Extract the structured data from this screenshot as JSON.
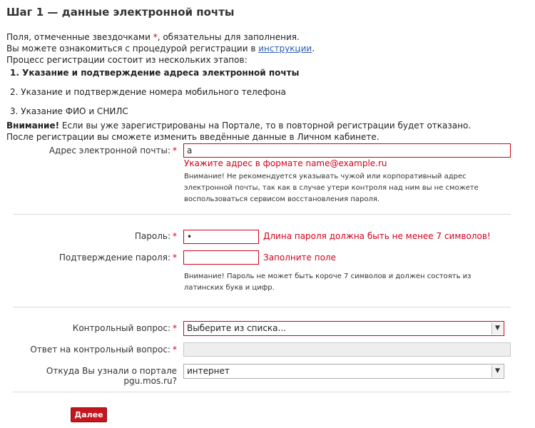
{
  "title": "Шаг 1 — данные электронной почты",
  "intro": {
    "line1_before": "Поля, отмеченные звездочками ",
    "asterisk": "*",
    "line1_after": ", обязательны для заполнения.",
    "line2_before": "Вы можете ознакомиться с процедурой регистрации в ",
    "link": "инструкции",
    "line2_after": ".",
    "line3": "Процесс регистрации состоит из нескольких этапов:"
  },
  "steps": [
    "1.  Указание и подтверждение адреса электронной почты",
    "2.  Указание и подтверждение номера мобильного телефона",
    "3.  Указание ФИО и СНИЛС"
  ],
  "notice": {
    "bold": "Внимание!",
    "line1": " Если вы уже зарегистрированы на Портале, то в повторной регистрации будет отказано.",
    "line2": "После регистрации вы сможете изменить введённые данные в Личном кабинете."
  },
  "form": {
    "email": {
      "label": "Адрес электронной почты:",
      "value": "a",
      "error": "Укажите адрес в формате name@example.ru",
      "hint": "Внимание! Не рекомендуется указывать чужой или корпоративный адрес электронной почты, так как в случае утери контроля над ним вы не сможете воспользоваться сервисом восстановления пароля."
    },
    "password": {
      "label": "Пароль:",
      "value": "•",
      "error": "Длина пароля должна быть не менее 7 символов!"
    },
    "password_confirm": {
      "label": "Подтверждение пароля:",
      "value": "",
      "error": "Заполните поле"
    },
    "password_hint": "Внимание! Пароль не может быть короче 7 символов и должен состоять из латинских букв и цифр.",
    "question": {
      "label": "Контрольный вопрос:",
      "selected": "Выберите из списка..."
    },
    "answer": {
      "label": "Ответ на контрольный вопрос:",
      "value": ""
    },
    "source": {
      "label": "Откуда Вы узнали о портале pgu.mos.ru?",
      "selected": "интернет"
    },
    "asterisk": "*"
  },
  "submit_label": "Далее",
  "colors": {
    "error": "#d0021b",
    "button": "#c4161c",
    "link": "#2a5db0"
  }
}
